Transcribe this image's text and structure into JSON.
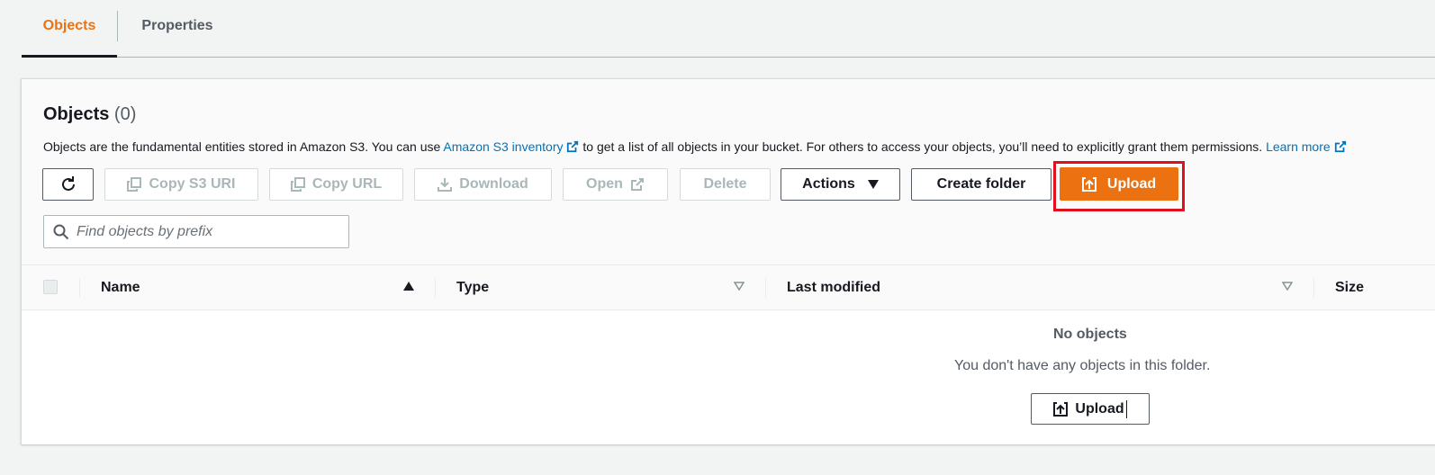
{
  "tabs": [
    {
      "label": "Objects",
      "active": true
    },
    {
      "label": "Properties",
      "active": false
    }
  ],
  "panel": {
    "title": "Objects",
    "count": "(0)",
    "description": {
      "text1": "Objects are the fundamental entities stored in Amazon S3. You can use ",
      "link1": "Amazon S3 inventory",
      "text2": " to get a list of all objects in your bucket. For others to access your objects, you’ll need to explicitly grant them permissions.",
      "link2": "Learn more"
    }
  },
  "toolbar": {
    "refresh_icon": "refresh-icon",
    "copy_s3_uri": "Copy S3 URI",
    "copy_url": "Copy URL",
    "download": "Download",
    "open": "Open",
    "delete": "Delete",
    "actions": "Actions",
    "create_folder": "Create folder",
    "upload": "Upload"
  },
  "search": {
    "placeholder": "Find objects by prefix",
    "value": ""
  },
  "table": {
    "columns": [
      "Name",
      "Type",
      "Last modified",
      "Size"
    ],
    "rows": []
  },
  "empty_state": {
    "title": "No objects",
    "description": "You don't have any objects in this folder.",
    "button": "Upload"
  },
  "colors": {
    "accent": "#ec7211",
    "link": "#0073bb",
    "highlight": "#e0101e"
  }
}
